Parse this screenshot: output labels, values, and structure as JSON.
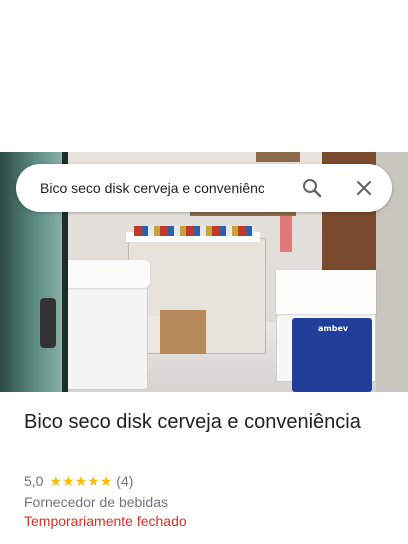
{
  "search": {
    "query": "Bico seco disk cerveja e conveniência"
  },
  "photo": {
    "crate_brand": "ambev"
  },
  "place": {
    "name": "Bico seco disk cerveja e conveniência",
    "rating": "5,0",
    "stars": 5,
    "review_count": "(4)",
    "category": "Fornecedor de bebidas",
    "status": "Temporariamente fechado"
  },
  "colors": {
    "star": "#fbbc04",
    "status_closed": "#d93025",
    "secondary_text": "#70757a"
  },
  "icons": {
    "search": "search-icon",
    "close": "close-icon"
  }
}
